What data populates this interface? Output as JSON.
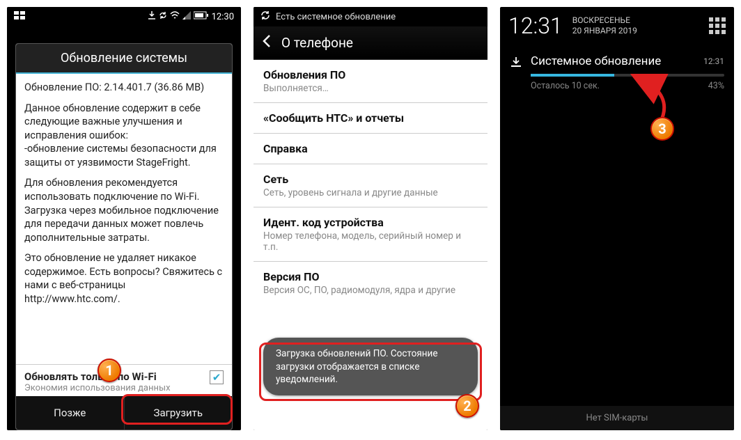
{
  "phone1": {
    "statusbar": {
      "time": "12:30"
    },
    "dialog": {
      "title": "Обновление системы",
      "line_version": "Обновление ПО: 2.14.401.7 (36.86 МВ)",
      "para1": "Данное обновление содержит в себе следующие важные улучшения и исправления ошибок:",
      "para1_item": "-обновление системы безопасности для защиты от уязвимости StageFright.",
      "para2": "Для обновления рекомендуется использовать подключение по Wi-Fi. Загрузка через мобильное подключение для передачи данных может повлечь дополнительные затраты.",
      "para3": "Это обновление не удаляет никакое содержимое. Есть вопросы? Свяжитесь с нами с веб-страницы http://www.htc.com/.",
      "wifi_title": "Обновлять только по Wi-Fi",
      "wifi_sub": "Экономия использования данных",
      "btn_later": "Позже",
      "btn_download": "Загрузить"
    }
  },
  "phone2": {
    "ticker": "Есть системное обновление",
    "header": "О телефоне",
    "items": [
      {
        "title": "Обновления ПО",
        "sub": "Выполняется…"
      },
      {
        "title": "«Сообщить HTC» и отчеты",
        "sub": ""
      },
      {
        "title": "Справка",
        "sub": ""
      },
      {
        "title": "Сеть",
        "sub": "Сеть, уровень сигнала и другие данные"
      },
      {
        "title": "Идент. код устройства",
        "sub": "Номер телефона, модель, серийный номер и т.п."
      },
      {
        "title": "Версия ПО",
        "sub": "Версия ОС, ПО, радиомодуля, ядра и другие"
      }
    ],
    "toast": "Загрузка обновлений ПО. Состояние загрузки отображается в списке уведомлений."
  },
  "phone3": {
    "clock": "12:31",
    "day": "ВОСКРЕСЕНЬЕ",
    "date": "20 ЯНВАРЯ 2019",
    "notif": {
      "title": "Системное обновление",
      "time": "12:31",
      "remaining": "Осталось 10 сек.",
      "percent": "43%"
    },
    "bottom": "Нет SIM-карты"
  },
  "anno": {
    "n1": "1",
    "n2": "2",
    "n3": "3"
  }
}
